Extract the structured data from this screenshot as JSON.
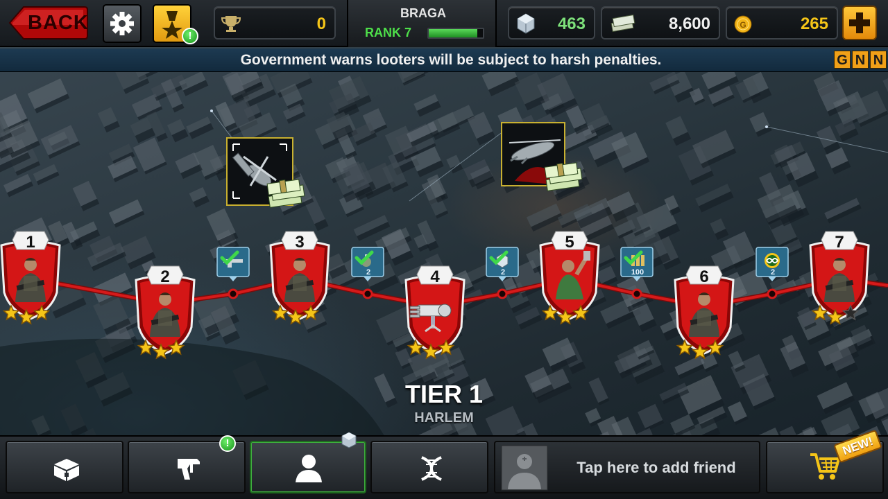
{
  "header": {
    "back_label": "BACK",
    "trophies": "0",
    "player_name": "BRAGA",
    "rank_label": "RANK 7",
    "rank_progress": 0.9,
    "gems": "463",
    "cash": "8,600",
    "gold": "265"
  },
  "ticker": {
    "text": "Government warns looters will be subject to harsh penalties.",
    "logo_letters": [
      "G",
      "N",
      "N"
    ]
  },
  "levels": [
    {
      "number": "1",
      "stars": 3,
      "portrait": "soldier"
    },
    {
      "number": "2",
      "stars": 3,
      "portrait": "soldier"
    },
    {
      "number": "3",
      "stars": 3,
      "portrait": "soldier"
    },
    {
      "number": "4",
      "stars": 3,
      "portrait": "minigun"
    },
    {
      "number": "5",
      "stars": 3,
      "portrait": "brawler"
    },
    {
      "number": "6",
      "stars": 3,
      "portrait": "soldier"
    },
    {
      "number": "7",
      "stars": 2,
      "portrait": "soldier"
    }
  ],
  "path_rewards": [
    {
      "icon": "rifle-icon",
      "count": "",
      "completed": true
    },
    {
      "icon": "grenade-icon",
      "count": "2",
      "completed": true
    },
    {
      "icon": "gem-icon",
      "count": "2",
      "completed": true
    },
    {
      "icon": "ammo-icon",
      "count": "100",
      "completed": true
    },
    {
      "icon": "infinity-ammo-icon",
      "count": "2",
      "completed": false
    }
  ],
  "map_rewards": [
    {
      "icon": "helicopter-icon",
      "bonus": "cash-stack-icon"
    },
    {
      "icon": "gunship-icon",
      "bonus": "cash-stack-icon"
    }
  ],
  "tier": {
    "title": "TIER 1",
    "region": "HARLEM"
  },
  "footer": {
    "nav_items": [
      "chest-icon",
      "weapon-icon",
      "profile-icon",
      "dna-icon"
    ],
    "friend_prompt": "Tap here to add friend",
    "new_badge": "NEW!"
  },
  "colors": {
    "accent_red": "#d41616",
    "gold": "#f5c518",
    "path_red": "#c81414",
    "ticker_blue": "#1d3a52"
  }
}
